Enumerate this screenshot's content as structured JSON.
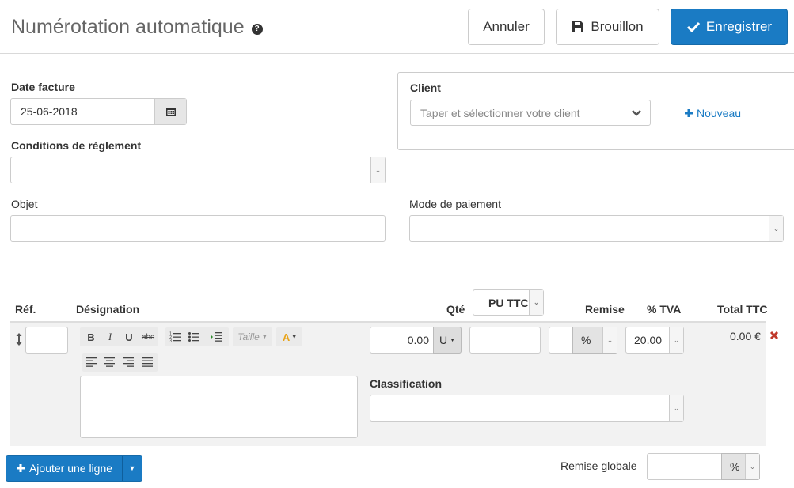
{
  "header": {
    "title": "Numérotation automatique",
    "help_icon": "?",
    "cancel_label": "Annuler",
    "draft_label": "Brouillon",
    "save_label": "Enregistrer"
  },
  "form": {
    "date_label": "Date facture",
    "date_value": "25-06-2018",
    "conditions_label": "Conditions de règlement",
    "conditions_value": "",
    "object_label": "Objet",
    "object_value": "",
    "payment_label": "Mode de paiement",
    "payment_value": "",
    "client_label": "Client",
    "client_placeholder": "Taper et sélectionner votre client",
    "new_label": "Nouveau"
  },
  "table": {
    "headers": {
      "ref": "Réf.",
      "designation": "Désignation",
      "qty": "Qté",
      "pu": "PU TTC",
      "discount": "Remise",
      "vat": "% TVA",
      "total": "Total TTC"
    },
    "row": {
      "ref": "",
      "qty": "0.00",
      "unit": "U",
      "price": "",
      "discount": "",
      "discount_unit": "%",
      "vat": "20.00",
      "total": "0.00 €",
      "classification_label": "Classification",
      "classification_value": "",
      "editor": {
        "bold": "B",
        "italic": "I",
        "underline": "U",
        "strike": "abc",
        "size_label": "Taille",
        "color_label": "A"
      }
    }
  },
  "footer": {
    "add_line_label": "Ajouter une ligne",
    "global_discount_label": "Remise globale",
    "global_discount_value": "",
    "global_discount_unit": "%"
  },
  "icons": {
    "save": "check-icon",
    "draft": "floppy-icon",
    "calendar": "calendar-icon",
    "add": "plus-icon",
    "drag": "move-vertical-icon",
    "delete": "close-icon"
  },
  "colors": {
    "primary": "#1a7bc4",
    "delete": "#c0392b",
    "row_bg": "#f2f2f2"
  }
}
